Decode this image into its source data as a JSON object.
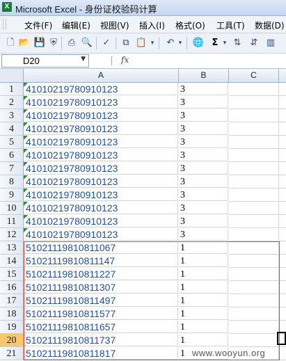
{
  "window": {
    "title": "Microsoft Excel - 身份证校验码计算",
    "app_icon": "X"
  },
  "menu": [
    "文件(F)",
    "编辑(E)",
    "视图(V)",
    "插入(I)",
    "格式(O)",
    "工具(T)",
    "数据(D)"
  ],
  "toolbar": {
    "icons": [
      "new-icon",
      "open-icon",
      "save-icon",
      "permission-icon",
      "print-icon",
      "print-preview-icon",
      "spelling-icon",
      "copy-icon",
      "paste-icon",
      "undo-icon",
      "hyperlink-icon",
      "autosum-icon",
      "sort-icon",
      "chart-icon"
    ],
    "autosum_label": "Σ"
  },
  "formula_bar": {
    "name_box": "D20",
    "fx_label": "fx",
    "formula": ""
  },
  "columns": [
    "A",
    "B",
    "C"
  ],
  "rows": [
    {
      "n": "1",
      "a": "41010219780910123",
      "b": "3"
    },
    {
      "n": "2",
      "a": "41010219780910123",
      "b": "3"
    },
    {
      "n": "3",
      "a": "41010219780910123",
      "b": "3"
    },
    {
      "n": "4",
      "a": "41010219780910123",
      "b": "3"
    },
    {
      "n": "5",
      "a": "41010219780910123",
      "b": "3"
    },
    {
      "n": "6",
      "a": "41010219780910123",
      "b": "3"
    },
    {
      "n": "7",
      "a": "41010219780910123",
      "b": "3"
    },
    {
      "n": "8",
      "a": "41010219780910123",
      "b": "3"
    },
    {
      "n": "9",
      "a": "41010219780910123",
      "b": "3"
    },
    {
      "n": "10",
      "a": "41010219780910123",
      "b": "3"
    },
    {
      "n": "11",
      "a": "41010219780910123",
      "b": "3"
    },
    {
      "n": "12",
      "a": "41010219780910123",
      "b": "3"
    },
    {
      "n": "13",
      "a": "51021119810811067",
      "b": "1"
    },
    {
      "n": "14",
      "a": "51021119810811147",
      "b": "1"
    },
    {
      "n": "15",
      "a": "51021119810811227",
      "b": "1"
    },
    {
      "n": "16",
      "a": "51021119810811307",
      "b": "1"
    },
    {
      "n": "17",
      "a": "51021119810811497",
      "b": "1"
    },
    {
      "n": "18",
      "a": "51021119810811577",
      "b": "1"
    },
    {
      "n": "19",
      "a": "51021119810811657",
      "b": "1"
    },
    {
      "n": "20",
      "a": "51021119810811737",
      "b": "1"
    },
    {
      "n": "21",
      "a": "51021119810811817",
      "b": "1"
    }
  ],
  "active_row": "20",
  "watermark": "www.wooyun.org",
  "colors": {
    "cell_text": "#1f4f9e",
    "highlight_box": "#d94a4a",
    "active_row_header": "#f7c86b"
  }
}
